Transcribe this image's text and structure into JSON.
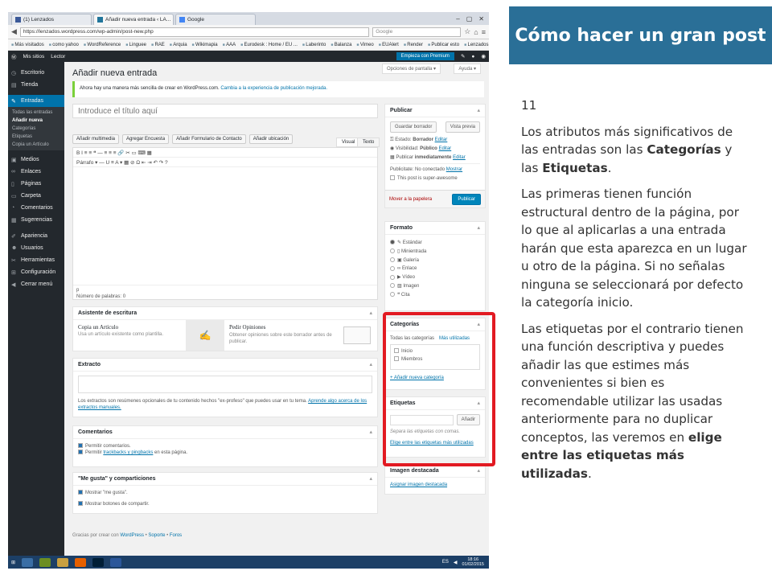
{
  "slide": {
    "title": "Cómo hacer un gran post",
    "number": "11",
    "p1_a": "Los atributos más significativos de las entradas son las ",
    "p1_b": "Categorías",
    "p1_c": " y las ",
    "p1_d": "Etiquetas",
    "p1_e": ".",
    "p2": "Las primeras tienen función estructural dentro de la página, por lo que al aplicarlas a una entrada harán que esta aparezca en un lugar u otro de la página. Si no señalas ninguna se seleccionará por defecto la categoría inicio.",
    "p3_a": "Las etiquetas por el contrario tienen una función descriptiva y puedes añadir las que estimes más convenientes si bien es recomendable utilizar las usadas anteriormente para no duplicar conceptos, las veremos en ",
    "p3_b": "elige entre las etiquetas más utilizadas",
    "p3_c": "."
  },
  "browser": {
    "tabs": [
      "(1) Lenzados",
      "Añadir nueva entrada ‹ LA...",
      "Google"
    ],
    "url": "https://lenzados.wordpress.com/wp-admin/post-new.php",
    "search_placeholder": "Google",
    "bookmarks": [
      "Más visitados",
      "como yahoo",
      "WordReference",
      "Linguee",
      "RAE",
      "Arquia",
      "Wikimapia",
      "AAA",
      "Eurodesk : Home / EU ...",
      "Laberinto",
      "Balanza",
      "Vimeo",
      "EUAlert",
      "Render",
      "Publicar esto",
      "Lenzados"
    ]
  },
  "adminbar": {
    "sites": "Mis sitios",
    "reader": "Lector",
    "premium": "Empieza con Premium"
  },
  "sidebar": {
    "items": [
      "Escritorio",
      "Tienda",
      "Entradas",
      "Medios",
      "Enlaces",
      "Páginas",
      "Carpeta",
      "Comentarios",
      "Sugerencias",
      "Apariencia",
      "Usuarios",
      "Herramientas",
      "Configuración",
      "Cerrar menú"
    ],
    "sub": [
      "Todas las entradas",
      "Añadir nueva",
      "Categorías",
      "Etiquetas",
      "Copia un Artículo"
    ]
  },
  "main": {
    "screen_options": "Opciones de pantalla ▾",
    "help": "Ayuda ▾",
    "page_title": "Añadir nueva entrada",
    "notice": "Ahora hay una manera más sencilla de crear en WordPress.com.",
    "notice_link": "Cambia a la experiencia de publicación mejorada.",
    "title_placeholder": "Introduce el título aquí",
    "media_buttons": [
      "Añadir multimedia",
      "Agregar Encuesta",
      "Añadir Formulario de Contacto",
      "Añadir ubicación"
    ],
    "visual_tab": "Visual",
    "text_tab": "Texto",
    "toolbar1": "B   I   ≡   ≡   ❝   —   ≡   ≡   ≡   🔗   ✂   ▭   ⌨   ▦",
    "toolbar2": "Párrafo   ▾   —   U   ≡   A ▾   ▦   ⊘   Ω   ⇤   ⇥   ↶   ↷   ?",
    "path": "p",
    "word_count": "Número de palabras: 0"
  },
  "writing_assistant": {
    "title": "Asistente de escritura",
    "copy_title": "Copia un Artículo",
    "copy_desc": "Usa un artículo existente como plantilla.",
    "feedback_title": "Pedir Opiniones",
    "feedback_desc": "Obtener opiniones sobre este borrador antes de publicar."
  },
  "excerpt": {
    "title": "Extracto",
    "help": "Los extractos son resúmenes opcionales de tu contenido hechos \"ex-profeso\" que puedes usar en tu tema.",
    "help_link": "Aprende algo acerca de los extractos manuales."
  },
  "comments": {
    "title": "Comentarios",
    "allow": "Permitir comentarios.",
    "allow_pre": "Permitir",
    "trackbacks": "trackbacks y pingbacks",
    "trackbacks_post": "en esta página."
  },
  "likes": {
    "title": "\"Me gusta\" y comparticiones",
    "show_likes": "Mostrar \"me gusta\".",
    "show_share": "Mostrar botones de compartir."
  },
  "footer": {
    "prefix": "Gracias por crear con",
    "wp": "WordPress",
    "support": "Soporte",
    "forums": "Foros"
  },
  "publish": {
    "title": "Publicar",
    "save_draft": "Guardar borrador",
    "preview": "Vista previa",
    "status_label": "Estado:",
    "status_value": "Borrador",
    "visibility_label": "Visibilidad:",
    "visibility_value": "Público",
    "publish_label": "Publicar",
    "publish_value": "inmediatamente",
    "edit": "Editar",
    "publicize_label": "Publicitate: No conectado",
    "publicize_link": "Mostrar",
    "awesome": "This post is super-awesome",
    "trash": "Mover a la papelera",
    "publish_button": "Publicar"
  },
  "format": {
    "title": "Formato",
    "options": [
      "Estándar",
      "Minientrada",
      "Galería",
      "Enlace",
      "Vídeo",
      "Imagen",
      "Cita"
    ]
  },
  "categories": {
    "title": "Categorías",
    "tab_all": "Todas las categorías",
    "tab_used": "Más utilizadas",
    "items": [
      "Inicio",
      "Miembros"
    ],
    "add": "+ Añadir nueva categoría"
  },
  "tags": {
    "title": "Etiquetas",
    "add_button": "Añadir",
    "hint": "Separa las etiquetas con comas.",
    "choose": "Elige entre las etiquetas más utilizadas"
  },
  "featured": {
    "title": "Imagen destacada",
    "link": "Asignar imagen destacada"
  },
  "taskbar": {
    "lang": "ES",
    "time": "18:16",
    "date": "01/02/2015"
  },
  "colors": {
    "accent": "#2a6f97",
    "wp_blue": "#0073aa",
    "annotation": "#e21a22"
  }
}
